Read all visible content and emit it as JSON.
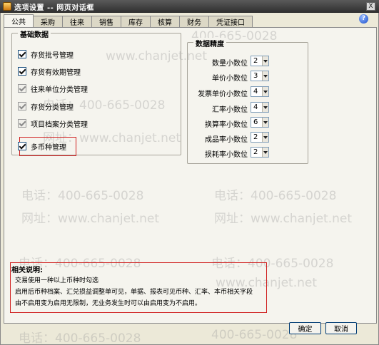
{
  "window": {
    "title": "选项设置 -- 网页对话框",
    "close_label": "X"
  },
  "tabs": [
    {
      "label": "公共",
      "active": true
    },
    {
      "label": "采购",
      "active": false
    },
    {
      "label": "往来",
      "active": false
    },
    {
      "label": "销售",
      "active": false
    },
    {
      "label": "库存",
      "active": false
    },
    {
      "label": "核算",
      "active": false
    },
    {
      "label": "财务",
      "active": false
    },
    {
      "label": "凭证接口",
      "active": false
    }
  ],
  "help_label": "?",
  "basic_data": {
    "title": "基础数据",
    "items": [
      {
        "label": "存货批号管理",
        "checked": true,
        "enabled": true
      },
      {
        "label": "存货有效期管理",
        "checked": true,
        "enabled": true
      },
      {
        "label": "往来单位分类管理",
        "checked": true,
        "enabled": false
      },
      {
        "label": "存货分类管理",
        "checked": true,
        "enabled": false
      },
      {
        "label": "项目档案分类管理",
        "checked": true,
        "enabled": false
      },
      {
        "label": "多币种管理",
        "checked": true,
        "enabled": true
      }
    ]
  },
  "precision": {
    "title": "数据精度",
    "rows": [
      {
        "label": "数量小数位",
        "value": "2"
      },
      {
        "label": "单价小数位",
        "value": "3"
      },
      {
        "label": "发票单价小数位",
        "value": "4"
      },
      {
        "label": "汇率小数位",
        "value": "4"
      },
      {
        "label": "换算率小数位",
        "value": "6"
      },
      {
        "label": "成品率小数位",
        "value": "2"
      },
      {
        "label": "损耗率小数位",
        "value": "2"
      }
    ]
  },
  "description": {
    "title": "相关说明:",
    "lines": [
      "交易使用一种以上币种时勾选",
      "启用后币种档案、汇兑损益调整单可见，单据、报表可见币种、汇率、本币相关字段",
      "由不启用变为启用无限制，无业务发生时可以由启用变为不启用。"
    ]
  },
  "buttons": {
    "ok": "确定",
    "cancel": "取消"
  },
  "watermarks": {
    "phone": "电话：400-665-0028",
    "site": "网址：www.chanjet.net",
    "site_short": "www.chanjet.net",
    "phone_short": "400-665-0028"
  }
}
